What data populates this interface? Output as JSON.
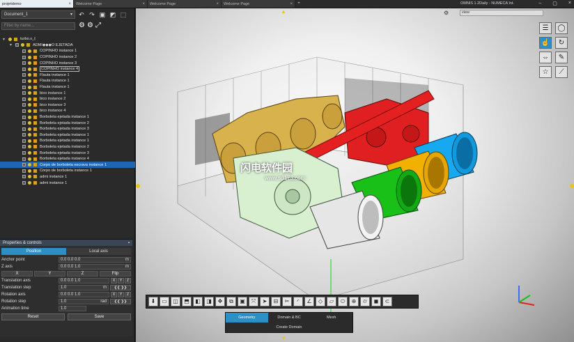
{
  "window": {
    "title": "OMNIS 1.2Daily - NUMECA Int.",
    "tabs": [
      {
        "label": "projetdemo",
        "active": true
      },
      {
        "label": "Welcome Page",
        "active": false
      },
      {
        "label": "Welcome Page",
        "active": false
      },
      {
        "label": "Welcome Page",
        "active": false
      }
    ]
  },
  "sidebar": {
    "document": "Document_1",
    "filter_placeholder": "Filter by name...",
    "tree": [
      {
        "label": "turbo.x_t",
        "level": 0
      },
      {
        "label": "ADMI◆◆◆O EJETADA",
        "level": 1
      },
      {
        "label": "COPINHO instance 1",
        "level": 2
      },
      {
        "label": "COPINHO instance 2",
        "level": 2
      },
      {
        "label": "COPINHO instance 3",
        "level": 2
      },
      {
        "label": "COPINHO instance 4",
        "level": 2,
        "highlight": true
      },
      {
        "label": "Flauta instance 1",
        "level": 2
      },
      {
        "label": "Flauta instance 1",
        "level": 2
      },
      {
        "label": "Flauta instance 1",
        "level": 2
      },
      {
        "label": "bico instance 1",
        "level": 2
      },
      {
        "label": "bico instance 2",
        "level": 2
      },
      {
        "label": "bico instance 3",
        "level": 2
      },
      {
        "label": "bico instance 4",
        "level": 2
      },
      {
        "label": "Borboleta ejetada instance 1",
        "level": 2
      },
      {
        "label": "Borboleta ejetada instance 2",
        "level": 2
      },
      {
        "label": "Borboleta ejetada instance 3",
        "level": 2
      },
      {
        "label": "Borboleta ejetada instance 1",
        "level": 2
      },
      {
        "label": "Borboleta ejetada instance 1",
        "level": 2
      },
      {
        "label": "Borboleta ejetada instance 2",
        "level": 2
      },
      {
        "label": "Borboleta ejetada instance 3",
        "level": 2
      },
      {
        "label": "Borboleta ejetada instance 4",
        "level": 2
      },
      {
        "label": "Corpo de borboleta escrava instance 1",
        "level": 2,
        "selected": true
      },
      {
        "label": "Corpo de borboleta instance 1",
        "level": 2
      },
      {
        "label": "admi instance 1",
        "level": 2
      },
      {
        "label": "admi instance 1",
        "level": 2
      }
    ]
  },
  "properties": {
    "title": "Properties & controls",
    "tabs": [
      "Position",
      "Local axis"
    ],
    "anchor_label": "Anchor point",
    "anchor_value": "0.0  0.0  0.0",
    "anchor_unit": "m",
    "zaxis_label": "Z axis",
    "zaxis_value": "0.0  0.0  1.0",
    "zaxis_unit": "m",
    "axes": [
      "X",
      "Y",
      "Z",
      "Flip"
    ],
    "translation_axis_label": "Translation axis",
    "translation_axis_value": "0.0  0.0  1.0",
    "translation_step_label": "Translation step",
    "translation_step_value": "1.0",
    "translation_step_unit": "m",
    "rotation_axis_label": "Rotation axis",
    "rotation_axis_value": "0.0  0.0  1.0",
    "rotation_step_label": "Rotation step",
    "rotation_step_value": "1.0",
    "rotation_step_unit": "rad",
    "animation_label": "Animation time",
    "animation_value": "1.0",
    "reset_label": "Reset",
    "save_label": "Save",
    "step_btns": "❮❮ ❯❯",
    "xyz": [
      "X",
      "Y",
      "Z"
    ]
  },
  "viewport": {
    "view_select": "view",
    "mode_tabs": [
      "Geometry",
      "Domain & BC",
      "Mesh"
    ],
    "create_domain": "Create Domain",
    "watermark_cn": "闪电软件园",
    "watermark_url": "www.sd173.com",
    "colors": {
      "red": "#e02020",
      "green": "#18c018",
      "yellow": "#f2b000",
      "blue": "#16a8f0",
      "gold": "#d8b24c",
      "pale_green": "#d8f0d0"
    }
  }
}
